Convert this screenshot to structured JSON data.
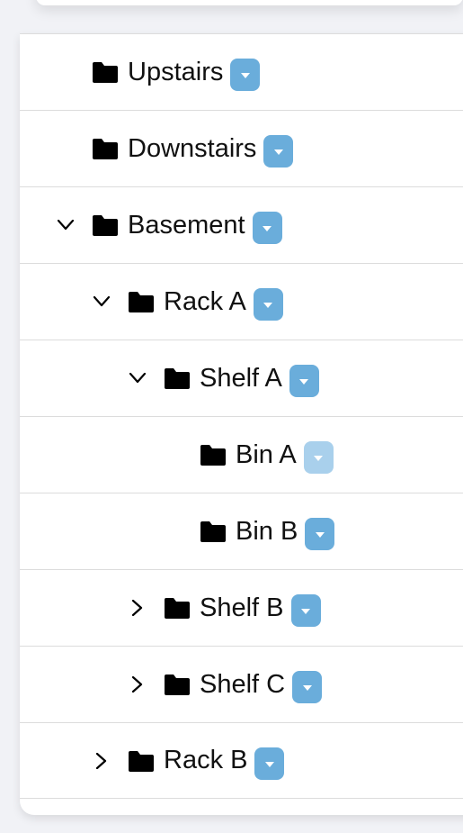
{
  "tree": {
    "rows": [
      {
        "label": "Upstairs",
        "level": 0,
        "expander": "none",
        "dropdown_disabled": false
      },
      {
        "label": "Downstairs",
        "level": 0,
        "expander": "none",
        "dropdown_disabled": false
      },
      {
        "label": "Basement",
        "level": 0,
        "expander": "expanded",
        "dropdown_disabled": false
      },
      {
        "label": "Rack A",
        "level": 1,
        "expander": "expanded",
        "dropdown_disabled": false
      },
      {
        "label": "Shelf A",
        "level": 2,
        "expander": "expanded",
        "dropdown_disabled": false
      },
      {
        "label": "Bin A",
        "level": 3,
        "expander": "none",
        "dropdown_disabled": true
      },
      {
        "label": "Bin B",
        "level": 3,
        "expander": "none",
        "dropdown_disabled": false
      },
      {
        "label": "Shelf B",
        "level": 2,
        "expander": "collapsed",
        "dropdown_disabled": false
      },
      {
        "label": "Shelf C",
        "level": 2,
        "expander": "collapsed",
        "dropdown_disabled": false
      },
      {
        "label": "Rack B",
        "level": 1,
        "expander": "collapsed",
        "dropdown_disabled": false
      }
    ]
  },
  "colors": {
    "dropdown": "#6aaddb",
    "dropdown_disabled": "#a9d0ec",
    "folder": "#000000"
  },
  "icons": {
    "expanded": "chevron-down-icon",
    "collapsed": "chevron-right-icon",
    "folder": "folder-icon",
    "dropdown": "caret-down-icon"
  }
}
